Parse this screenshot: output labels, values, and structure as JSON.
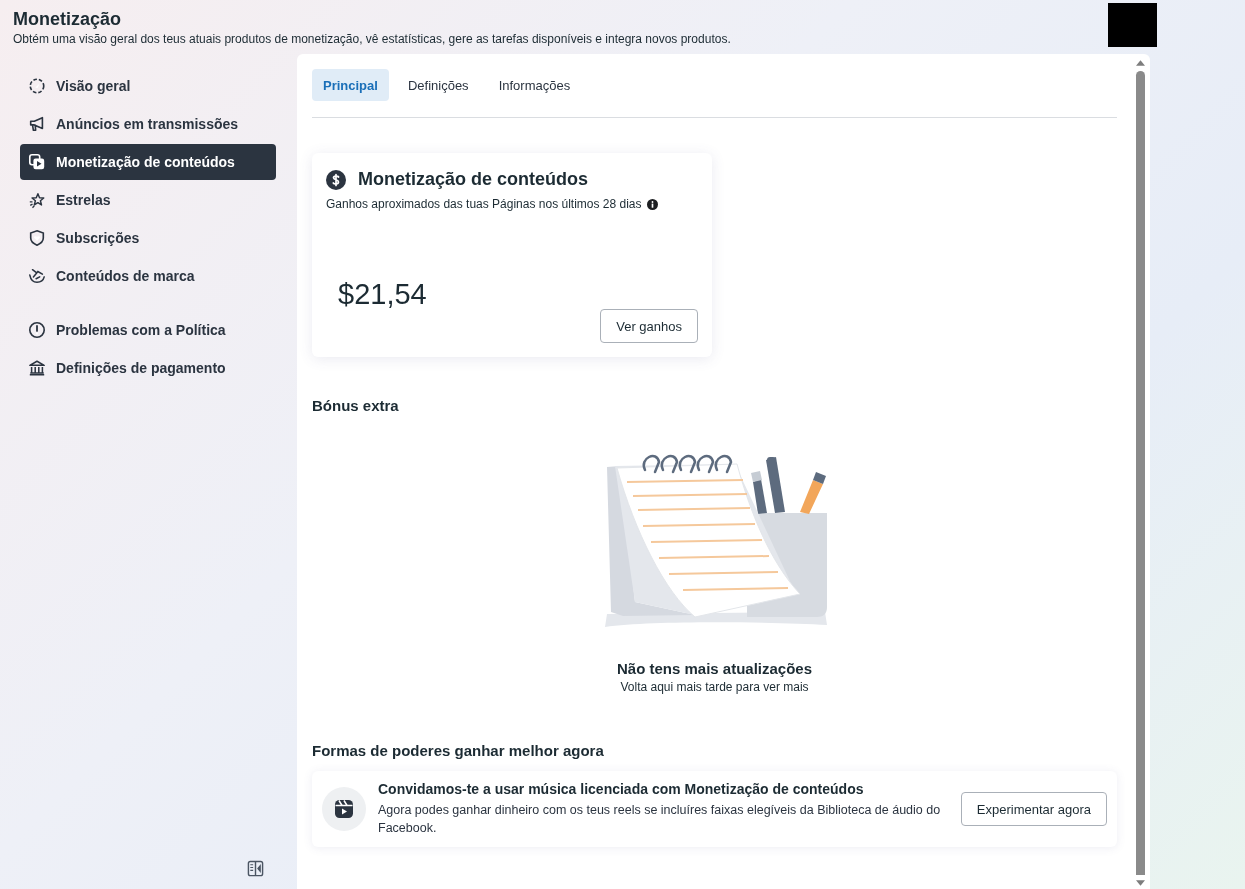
{
  "header": {
    "title": "Monetização",
    "subtitle": "Obtém uma visão geral dos teus atuais produtos de monetização, vê estatísticas, gere as tarefas disponíveis e integra novos produtos."
  },
  "sidebar": {
    "groups": [
      {
        "items": [
          {
            "label": "Visão geral",
            "selected": false
          },
          {
            "label": "Anúncios em transmissões",
            "selected": false
          },
          {
            "label": "Monetização de conteúdos",
            "selected": true
          },
          {
            "label": "Estrelas",
            "selected": false
          },
          {
            "label": "Subscrições",
            "selected": false
          },
          {
            "label": "Conteúdos de marca",
            "selected": false
          }
        ]
      },
      {
        "items": [
          {
            "label": "Problemas com a Política",
            "selected": false
          },
          {
            "label": "Definições de pagamento",
            "selected": false
          }
        ]
      }
    ]
  },
  "tabs": [
    {
      "label": "Principal",
      "selected": true
    },
    {
      "label": "Definições",
      "selected": false
    },
    {
      "label": "Informações",
      "selected": false
    }
  ],
  "earnings_card": {
    "title": "Monetização de conteúdos",
    "subtitle": "Ganhos aproximados das tuas Páginas nos últimos 28 dias",
    "amount": "$21,54",
    "button": "Ver ganhos"
  },
  "bonus": {
    "heading": "Bónus extra",
    "empty_title": "Não tens mais atualizações",
    "empty_text": "Volta aqui mais tarde para ver mais"
  },
  "ways": {
    "heading": "Formas de poderes ganhar melhor agora",
    "cards": [
      {
        "title": "Convidamos-te a usar música licenciada com Monetização de conteúdos",
        "text": "Agora podes ganhar dinheiro com os teus reels se incluíres faixas elegíveis da Biblioteca de áudio do Facebook.",
        "button": "Experimentar agora"
      }
    ]
  }
}
